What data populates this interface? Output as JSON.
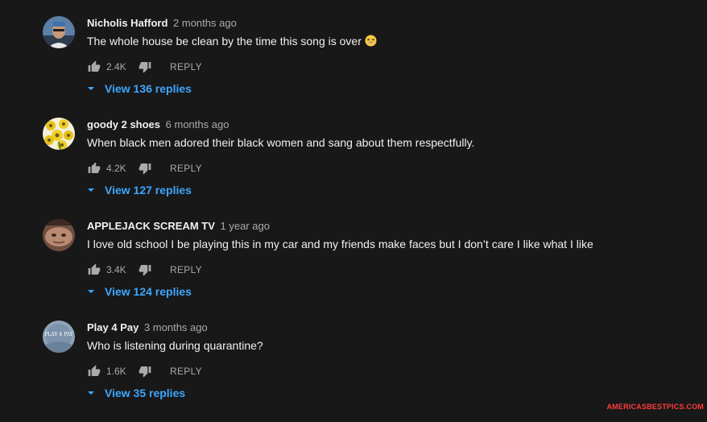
{
  "comments": [
    {
      "author": "Nicholis Hafford",
      "time": "2 months ago",
      "text": "The whole house be clean by the time this song is over",
      "emoji": "grinning-squinting-face",
      "likes": "2.4K",
      "reply_label": "REPLY",
      "view_replies": "View 136 replies"
    },
    {
      "author": "goody 2 shoes",
      "time": "6 months ago",
      "text": "When black men adored their black women and sang about them respectfully.",
      "likes": "4.2K",
      "reply_label": "REPLY",
      "view_replies": "View 127 replies"
    },
    {
      "author": "APPLEJACK SCREAM TV",
      "time": "1 year ago",
      "text": "I love old school I be playing this in my car and my friends make faces but I don’t care I like what I like",
      "likes": "3.4K",
      "reply_label": "REPLY",
      "view_replies": "View 124 replies"
    },
    {
      "author": "Play 4 Pay",
      "time": "3 months ago",
      "text": "Who is listening during quarantine?",
      "likes": "1.6K",
      "reply_label": "REPLY",
      "view_replies": "View 35 replies",
      "avatar_text": "PLAY 4 PAY"
    }
  ],
  "watermark": "AMERICASBESTPICS.COM",
  "colors": {
    "background": "#181818",
    "text": "#f1f1f1",
    "secondary": "#aaaaaa",
    "link": "#3ea6ff",
    "watermark": "#ff3b3b"
  },
  "icons": [
    "thumbs-up-icon",
    "thumbs-down-icon",
    "caret-down-icon"
  ]
}
